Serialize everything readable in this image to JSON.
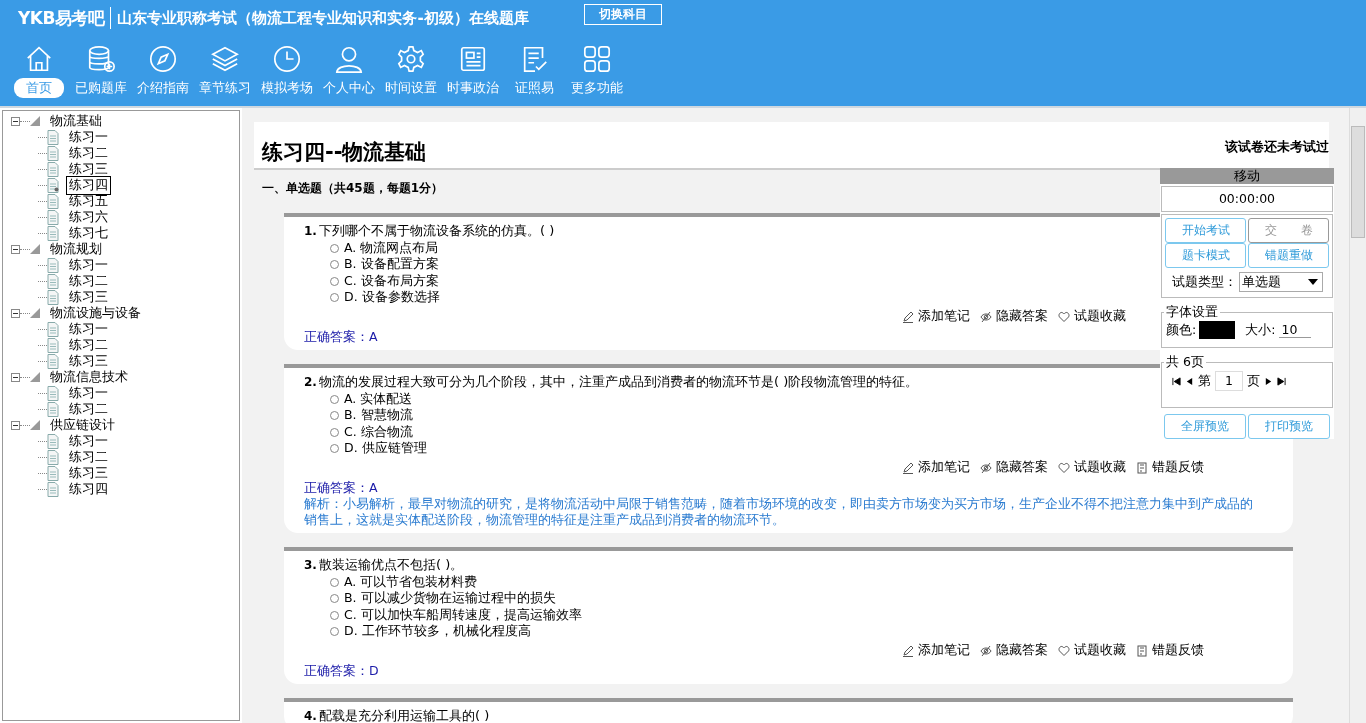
{
  "header": {
    "logo": "YKB易考吧",
    "title": "山东专业职称考试（物流工程专业知识和实务-初级）在线题库",
    "switch_button": "切换科目"
  },
  "nav": [
    {
      "label": "首页",
      "selected": true
    },
    {
      "label": "已购题库",
      "selected": false
    },
    {
      "label": "介绍指南",
      "selected": false
    },
    {
      "label": "章节练习",
      "selected": false
    },
    {
      "label": "模拟考场",
      "selected": false
    },
    {
      "label": "个人中心",
      "selected": false
    },
    {
      "label": "时间设置",
      "selected": false
    },
    {
      "label": "时事政治",
      "selected": false
    },
    {
      "label": "证照易",
      "selected": false
    },
    {
      "label": "更多功能",
      "selected": false
    }
  ],
  "tree": [
    {
      "label": "物流基础",
      "expanded": true,
      "children": [
        {
          "label": "练习一",
          "selected": false
        },
        {
          "label": "练习二",
          "selected": false
        },
        {
          "label": "练习三",
          "selected": false
        },
        {
          "label": "练习四",
          "selected": true
        },
        {
          "label": "练习五",
          "selected": false
        },
        {
          "label": "练习六",
          "selected": false
        },
        {
          "label": "练习七",
          "selected": false
        }
      ]
    },
    {
      "label": "物流规划",
      "expanded": true,
      "children": [
        {
          "label": "练习一",
          "selected": false
        },
        {
          "label": "练习二",
          "selected": false
        },
        {
          "label": "练习三",
          "selected": false
        }
      ]
    },
    {
      "label": "物流设施与设备",
      "expanded": true,
      "children": [
        {
          "label": "练习一",
          "selected": false
        },
        {
          "label": "练习二",
          "selected": false
        },
        {
          "label": "练习三",
          "selected": false
        }
      ]
    },
    {
      "label": "物流信息技术",
      "expanded": true,
      "children": [
        {
          "label": "练习一",
          "selected": false
        },
        {
          "label": "练习二",
          "selected": false
        }
      ]
    },
    {
      "label": "供应链设计",
      "expanded": true,
      "children": [
        {
          "label": "练习一",
          "selected": false
        },
        {
          "label": "练习二",
          "selected": false
        },
        {
          "label": "练习三",
          "selected": false
        },
        {
          "label": "练习四",
          "selected": false
        }
      ]
    }
  ],
  "paper": {
    "title": "练习四--物流基础",
    "status": "该试卷还未考试过",
    "section": "一、单选题（共45题，每题1分）"
  },
  "questions": [
    {
      "number": "1.",
      "text": "下列哪个不属于物流设备系统的仿真。( )",
      "actions": [
        "添加笔记",
        "隐藏答案",
        "试题收藏"
      ],
      "options": [
        {
          "label": "A. 物流网点布局",
          "selected": false
        },
        {
          "label": "B. 设备配置方案",
          "selected": false
        },
        {
          "label": "C. 设备布局方案",
          "selected": false
        },
        {
          "label": "D. 设备参数选择",
          "selected": false
        }
      ],
      "answer": "正确答案：A"
    },
    {
      "number": "2.",
      "text": "物流的发展过程大致可分为几个阶段，其中，注重产成品到消费者的物流环节是( )阶段物流管理的特征。",
      "actions": [
        "添加笔记",
        "隐藏答案",
        "试题收藏",
        "错题反馈"
      ],
      "options": [
        {
          "label": "A. 实体配送",
          "selected": false
        },
        {
          "label": "B. 智慧物流",
          "selected": false
        },
        {
          "label": "C. 综合物流",
          "selected": false
        },
        {
          "label": "D. 供应链管理",
          "selected": false
        }
      ],
      "answer": "正确答案：A",
      "analysis": "解析：小易解析，最早对物流的研究，是将物流活动中局限于销售范畴，随着市场环境的改变，即由卖方市场变为买方市场，生产企业不得不把注意力集中到产成品的销售上，这就是实体配送阶段，物流管理的特征是注重产成品到消费者的物流环节。"
    },
    {
      "number": "3.",
      "text": "散装运输优点不包括( )。",
      "actions": [
        "添加笔记",
        "隐藏答案",
        "试题收藏",
        "错题反馈"
      ],
      "options": [
        {
          "label": "A. 可以节省包装材料费",
          "selected": false
        },
        {
          "label": "B. 可以减少货物在运输过程中的损失",
          "selected": false
        },
        {
          "label": "C. 可以加快车船周转速度，提高运输效率",
          "selected": false
        },
        {
          "label": "D. 工作环节较多，机械化程度高",
          "selected": false
        }
      ],
      "answer": "正确答案：D"
    },
    {
      "number": "4.",
      "text": "配载是充分利用运输工具的( )"
    }
  ],
  "panel": {
    "title": "移动",
    "timer": "00:00:00",
    "buttons": [
      "开始考试",
      "交　　卷",
      "题卡模式",
      "错题重做"
    ],
    "type_label": "试题类型：",
    "type_value": "单选题",
    "font_legend": "字体设置",
    "color_label": "颜色:",
    "size_label": "大小:",
    "size_value": "10",
    "pages_legend": "共 6页",
    "page_prefix": "第",
    "page_value": "1",
    "page_suffix": "页",
    "bottom_buttons": [
      "全屏预览",
      "打印预览"
    ]
  }
}
